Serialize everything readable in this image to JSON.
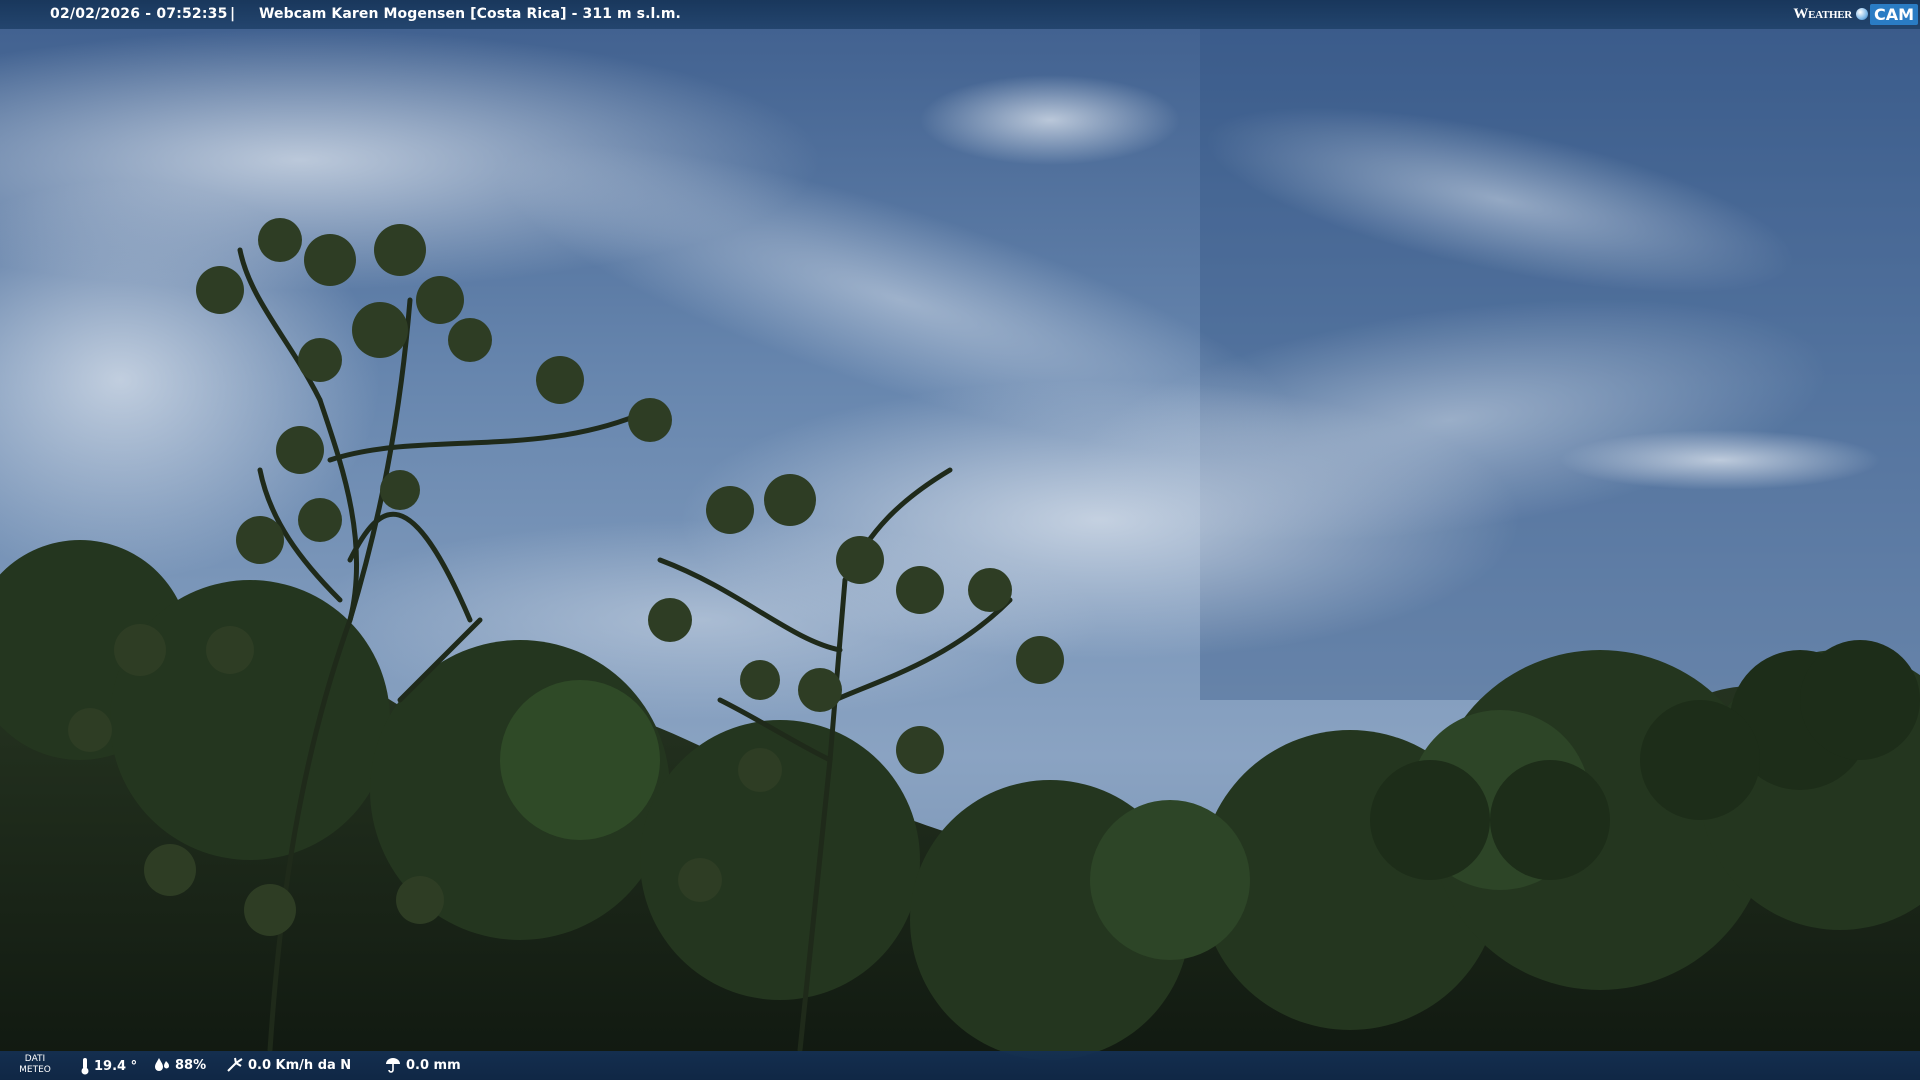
{
  "overlay_top": {
    "timestamp": "02/02/2026 - 07:52:35",
    "separator": "|",
    "title": "Webcam Karen Mogensen [Costa Rica]  - 311 m s.l.m."
  },
  "logo": {
    "weather_text": "Weather",
    "cam_text": "CAM"
  },
  "overlay_bottom": {
    "dati_line1": "DATI",
    "dati_line2": "METEO",
    "temperature": "19.4 °",
    "humidity": "88%",
    "wind": "0.0 Km/h da N",
    "rain": "0.0 mm"
  },
  "icons": {
    "temperature": "thermometer-icon",
    "humidity": "humidity-drop-icon",
    "wind": "wind-icon",
    "rain": "rain-gauge-icon"
  },
  "colors": {
    "bar_blue": "#163458",
    "logo_blue": "#2a7cc4",
    "sky": "#5c7fa8",
    "foliage": "#1e2a1a"
  }
}
